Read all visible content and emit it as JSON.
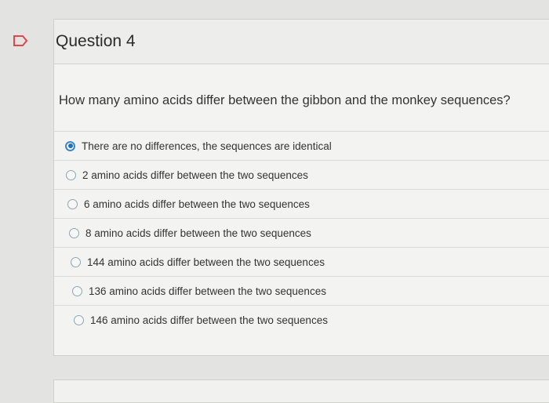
{
  "question": {
    "title": "Question 4",
    "text": "How many amino acids differ between the gibbon and the monkey sequences?",
    "selected_index": 0,
    "options": [
      "There are no differences, the sequences are identical",
      "2 amino acids differ between the two sequences",
      "6 amino acids differ between the two sequences",
      "8 amino acids differ between the two sequences",
      "144 amino acids differ between the two sequences",
      "136 amino acids differ between the two sequences",
      "146 amino acids differ between the two sequences"
    ]
  },
  "colors": {
    "selected_radio": "#1f6fb8",
    "flag_outline": "#e0474c"
  }
}
